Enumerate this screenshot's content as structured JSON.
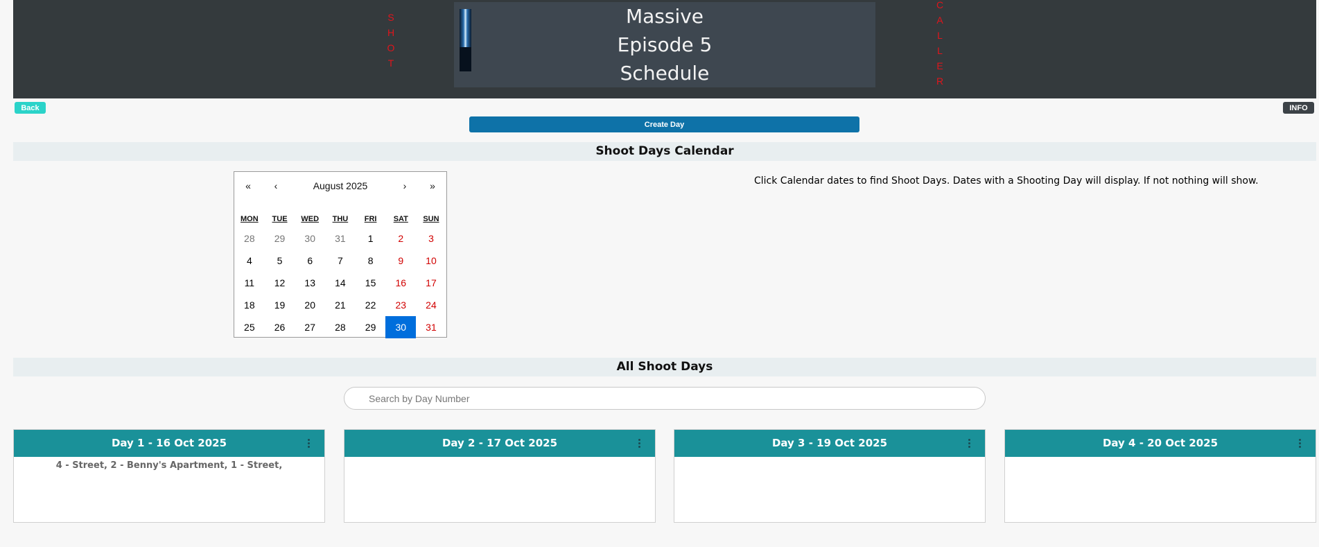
{
  "header": {
    "left_vertical": [
      "S",
      "H",
      "O",
      "T"
    ],
    "right_vertical": [
      "C",
      "A",
      "L",
      "L",
      "E",
      "R"
    ],
    "title_lines": [
      "Massive",
      "Episode 5",
      "Schedule"
    ]
  },
  "toolbar": {
    "back_label": "Back",
    "info_label": "INFO",
    "create_day_label": "Create Day"
  },
  "calendar_section": {
    "title": "Shoot Days Calendar",
    "hint": "Click Calendar dates to find Shoot Days. Dates with a Shooting Day will display. If not nothing will show."
  },
  "calendar": {
    "nav_prev_year": "«",
    "nav_prev_month": "‹",
    "month_label": "August 2025",
    "nav_next_month": "›",
    "nav_next_year": "»",
    "weekdays": [
      "MON",
      "TUE",
      "WED",
      "THU",
      "FRI",
      "SAT",
      "SUN"
    ],
    "days": [
      {
        "label": "28",
        "other": true
      },
      {
        "label": "29",
        "other": true
      },
      {
        "label": "30",
        "other": true
      },
      {
        "label": "31",
        "other": true
      },
      {
        "label": "1"
      },
      {
        "label": "2",
        "weekend": true
      },
      {
        "label": "3",
        "weekend": true
      },
      {
        "label": "4"
      },
      {
        "label": "5"
      },
      {
        "label": "6"
      },
      {
        "label": "7"
      },
      {
        "label": "8"
      },
      {
        "label": "9",
        "weekend": true
      },
      {
        "label": "10",
        "weekend": true
      },
      {
        "label": "11"
      },
      {
        "label": "12"
      },
      {
        "label": "13"
      },
      {
        "label": "14"
      },
      {
        "label": "15"
      },
      {
        "label": "16",
        "weekend": true
      },
      {
        "label": "17",
        "weekend": true
      },
      {
        "label": "18"
      },
      {
        "label": "19"
      },
      {
        "label": "20"
      },
      {
        "label": "21"
      },
      {
        "label": "22"
      },
      {
        "label": "23",
        "weekend": true
      },
      {
        "label": "24",
        "weekend": true
      },
      {
        "label": "25"
      },
      {
        "label": "26"
      },
      {
        "label": "27"
      },
      {
        "label": "28"
      },
      {
        "label": "29"
      },
      {
        "label": "30",
        "selected": true
      },
      {
        "label": "31",
        "weekend": true
      }
    ]
  },
  "all_days_section": {
    "title": "All Shoot Days",
    "search_placeholder": "Search by Day Number"
  },
  "cards": [
    {
      "title": "Day 1 - 16 Oct 2025",
      "body": "4 - Street, 2 - Benny's Apartment, 1 - Street,"
    },
    {
      "title": "Day 2 - 17 Oct 2025",
      "body": ""
    },
    {
      "title": "Day 3 - 19 Oct 2025",
      "body": ""
    },
    {
      "title": "Day 4 - 20 Oct 2025",
      "body": ""
    }
  ],
  "colors": {
    "header_bg": "#343a3d",
    "accent_red": "#e0151c",
    "back_button": "#2bd3c9",
    "create_button": "#0e72a8",
    "card_header": "#1a9199",
    "selected_day": "#006edc"
  }
}
